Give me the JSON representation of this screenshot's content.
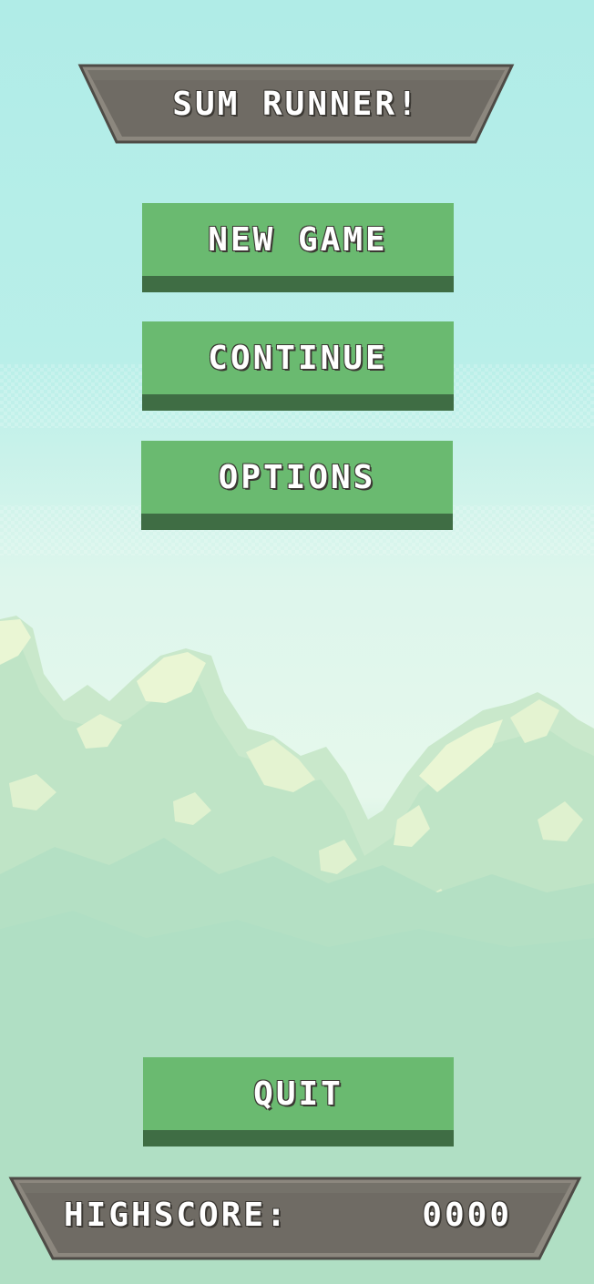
{
  "title": "SUM RUNNER!",
  "menu": {
    "new_game": "NEW GAME",
    "continue": "CONTINUE",
    "options": "OPTIONS",
    "quit": "QUIT"
  },
  "highscore": {
    "label": "HIGHSCORE:",
    "value": "0000"
  },
  "colors": {
    "sky_top": "#b2ede8",
    "sky_mid": "#def6ec",
    "ground": "#b0e0c5",
    "button": "#6aba70",
    "button_shadow": "#3f6d44",
    "stone": "#6e6a63"
  }
}
